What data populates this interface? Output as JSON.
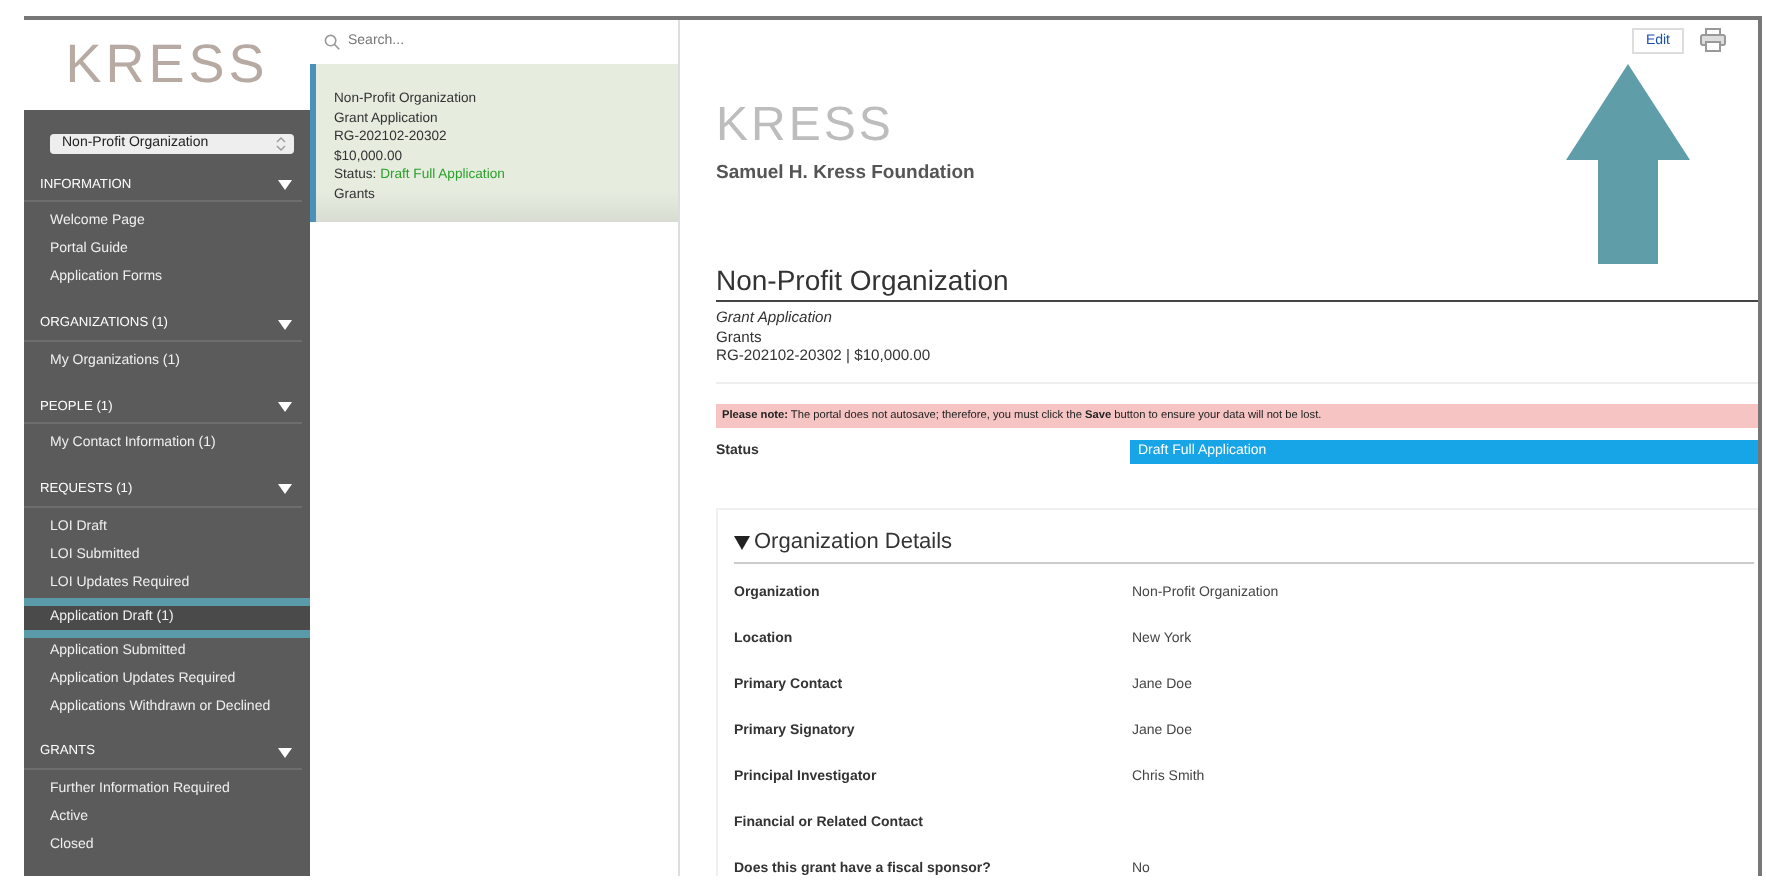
{
  "sidebar": {
    "logo": "KRESS",
    "org_select": {
      "value": "Non-Profit Organization"
    },
    "sections": [
      {
        "title": "INFORMATION",
        "expanded": true,
        "items": [
          {
            "label": "Welcome Page",
            "selected": false
          },
          {
            "label": "Portal Guide",
            "selected": false
          },
          {
            "label": "Application Forms",
            "selected": false
          }
        ]
      },
      {
        "title": "ORGANIZATIONS (1)",
        "expanded": true,
        "items": [
          {
            "label": "My Organizations  (1)",
            "selected": false
          }
        ]
      },
      {
        "title": "PEOPLE (1)",
        "expanded": true,
        "items": [
          {
            "label": "My Contact Information  (1)",
            "selected": false
          }
        ]
      },
      {
        "title": "REQUESTS (1)",
        "expanded": true,
        "items": [
          {
            "label": "LOI Draft",
            "selected": false
          },
          {
            "label": "LOI Submitted",
            "selected": false
          },
          {
            "label": "LOI Updates Required",
            "selected": false
          },
          {
            "label": "Application Draft  (1)",
            "selected": true
          },
          {
            "label": "Application Submitted",
            "selected": false
          },
          {
            "label": "Application Updates Required",
            "selected": false
          },
          {
            "label": "Applications Withdrawn or Declined",
            "selected": false
          }
        ]
      },
      {
        "title": "GRANTS",
        "expanded": true,
        "items": [
          {
            "label": "Further Information Required",
            "selected": false
          },
          {
            "label": "Active",
            "selected": false
          },
          {
            "label": "Closed",
            "selected": false
          }
        ]
      }
    ]
  },
  "list": {
    "search": {
      "placeholder": "Search..."
    },
    "records": [
      {
        "selected": true,
        "lines": [
          "Non-Profit Organization",
          "Grant Application",
          "RG-202102-20302",
          "$10,000.00"
        ],
        "status_label": "Status:",
        "status_value": "Draft Full Application",
        "program": "Grants"
      }
    ]
  },
  "detail": {
    "edit_button": "Edit",
    "logo": "KRESS",
    "foundation": "Samuel H. Kress Foundation",
    "title": "Non-Profit Organization",
    "subtitle": "Grant Application",
    "program": "Grants",
    "reference": "RG-202102-20302 | $10,000.00",
    "note": "**Please note:** The portal does not autosave; therefore, you must click the **Save** button to ensure your data will not be lost.",
    "status": {
      "label": "Status",
      "value": "Draft Full Application"
    },
    "section": {
      "title": "Organization Details",
      "expanded": true,
      "fields": [
        {
          "label": "Organization",
          "value": "Non-Profit Organization"
        },
        {
          "label": "Location",
          "value": "New York"
        },
        {
          "label": "Primary Contact",
          "value": "Jane Doe"
        },
        {
          "label": "Primary Signatory",
          "value": "Jane Doe"
        },
        {
          "label": "Principal Investigator",
          "value": "Chris Smith"
        },
        {
          "label": "Financial or Related Contact"
        },
        {
          "label": "Does this grant have a fiscal sponsor?",
          "value": "No"
        }
      ]
    }
  }
}
